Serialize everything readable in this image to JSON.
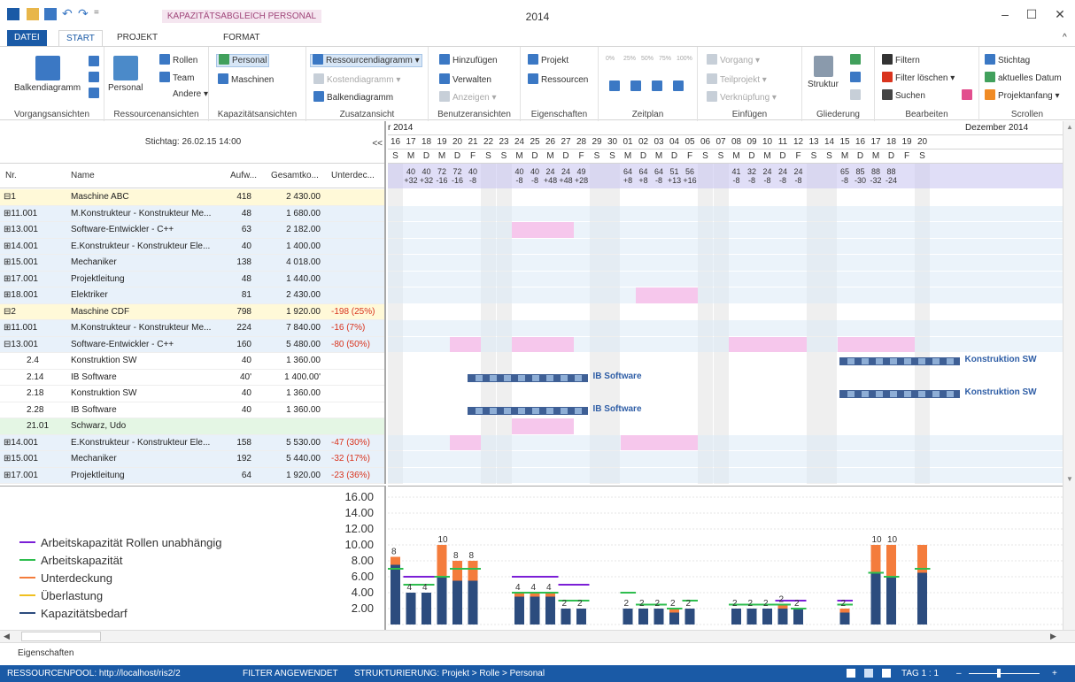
{
  "window": {
    "title": "2014",
    "context_tab_title": "KAPAZITÄTSABGLEICH PERSONAL",
    "min_label": "–",
    "max_label": "☐",
    "close_label": "✕",
    "collapse_label": "^"
  },
  "tabs": [
    {
      "label": "DATEI"
    },
    {
      "label": "START"
    },
    {
      "label": "PROJEKT"
    },
    {
      "label": "FORMAT"
    }
  ],
  "ribbon": {
    "vorgangsansichten": {
      "label": "Vorgangsansichten",
      "balkendiagramm": "Balkendiagramm"
    },
    "ressourcenansichten": {
      "label": "Ressourcenansichten",
      "personal": "Personal",
      "rollen": "Rollen",
      "team": "Team",
      "andere": "Andere ▾"
    },
    "kapazitaetsansichten": {
      "label": "Kapazitätsansichten",
      "personal": "Personal",
      "maschinen": "Maschinen"
    },
    "zusatzansicht": {
      "label": "Zusatzansicht",
      "ressourcendiagramm": "Ressourcendiagramm",
      "kostendiagramm": "Kostendiagramm ▾",
      "balkendiagramm": "Balkendiagramm"
    },
    "benutzeransichten": {
      "label": "Benutzeransichten",
      "hinzufuegen": "Hinzufügen",
      "verwalten": "Verwalten",
      "anzeigen": "Anzeigen ▾"
    },
    "eigenschaften": {
      "label": "Eigenschaften",
      "projekt": "Projekt",
      "ressourcen": "Ressourcen"
    },
    "zeitplan": {
      "label": "Zeitplan",
      "p0": "0%",
      "p25": "25%",
      "p50": "50%",
      "p75": "75%",
      "p100": "100%"
    },
    "einfuegen": {
      "label": "Einfügen",
      "vorgang": "Vorgang ▾",
      "teilprojekt": "Teilprojekt ▾",
      "verknuepfung": "Verknüpfung ▾"
    },
    "gliederung": {
      "label": "Gliederung",
      "struktur": "Struktur"
    },
    "bearbeiten": {
      "label": "Bearbeiten",
      "filtern": "Filtern",
      "filter_loeschen": "Filter löschen ▾",
      "suchen": "Suchen"
    },
    "scrollen": {
      "label": "Scrollen",
      "stichtag": "Stichtag",
      "aktuelles_datum": "aktuelles Datum",
      "projektanfang": "Projektanfang ▾"
    }
  },
  "left": {
    "stichtag": "Stichtag: 26.02.15 14:00",
    "collapse": "<<",
    "columns": [
      "Nr.",
      "Name",
      "Aufw...",
      "Gesamtko...",
      "Unterdec..."
    ],
    "rows": [
      {
        "nr": "⊟1",
        "name": "Maschine ABC",
        "aufw": "418",
        "kosten": "2 430.00",
        "unter": ""
      },
      {
        "nr": "⊞11.001",
        "name": "M.Konstrukteur - Konstrukteur Me...",
        "aufw": "48",
        "kosten": "1 680.00",
        "unter": ""
      },
      {
        "nr": "⊞13.001",
        "name": "Software-Entwickler - C++",
        "aufw": "63",
        "kosten": "2 182.00",
        "unter": ""
      },
      {
        "nr": "⊞14.001",
        "name": "E.Konstrukteur - Konstrukteur Ele...",
        "aufw": "40",
        "kosten": "1 400.00",
        "unter": ""
      },
      {
        "nr": "⊞15.001",
        "name": "Mechaniker",
        "aufw": "138",
        "kosten": "4 018.00",
        "unter": ""
      },
      {
        "nr": "⊞17.001",
        "name": "Projektleitung",
        "aufw": "48",
        "kosten": "1 440.00",
        "unter": ""
      },
      {
        "nr": "⊞18.001",
        "name": "Elektriker",
        "aufw": "81",
        "kosten": "2 430.00",
        "unter": ""
      },
      {
        "nr": "⊟2",
        "name": "Maschine CDF",
        "aufw": "798",
        "kosten": "1 920.00",
        "unter": "-198 (25%)"
      },
      {
        "nr": "⊞11.001",
        "name": "M.Konstrukteur - Konstrukteur Me...",
        "aufw": "224",
        "kosten": "7 840.00",
        "unter": "-16 (7%)"
      },
      {
        "nr": "⊟13.001",
        "name": "Software-Entwickler - C++",
        "aufw": "160",
        "kosten": "5 480.00",
        "unter": "-80 (50%)"
      },
      {
        "nr": "2.4",
        "name": "Konstruktion SW",
        "aufw": "40",
        "kosten": "1 360.00",
        "unter": ""
      },
      {
        "nr": "2.14",
        "name": "IB Software",
        "aufw": "40'",
        "kosten": "1 400.00'",
        "unter": ""
      },
      {
        "nr": "2.18",
        "name": "Konstruktion SW",
        "aufw": "40",
        "kosten": "1 360.00",
        "unter": ""
      },
      {
        "nr": "2.28",
        "name": "IB Software",
        "aufw": "40",
        "kosten": "1 360.00",
        "unter": ""
      },
      {
        "nr": "21.01",
        "name": "Schwarz, Udo",
        "aufw": "",
        "kosten": "",
        "unter": ""
      },
      {
        "nr": "⊞14.001",
        "name": "E.Konstrukteur - Konstrukteur Ele...",
        "aufw": "158",
        "kosten": "5 530.00",
        "unter": "-47 (30%)"
      },
      {
        "nr": "⊞15.001",
        "name": "Mechaniker",
        "aufw": "192",
        "kosten": "5 440.00",
        "unter": "-32 (17%)"
      },
      {
        "nr": "⊞17.001",
        "name": "Projektleitung",
        "aufw": "64",
        "kosten": "1 920.00",
        "unter": "-23 (36%)"
      }
    ]
  },
  "timeline": {
    "month_left": "r 2014",
    "month_right": "Dezember 2014",
    "days": [
      "16",
      "17",
      "18",
      "19",
      "20",
      "21",
      "22",
      "23",
      "24",
      "25",
      "26",
      "27",
      "28",
      "29",
      "30",
      "01",
      "02",
      "03",
      "04",
      "05",
      "06",
      "07",
      "08",
      "09",
      "10",
      "11",
      "12",
      "13",
      "14",
      "15",
      "16",
      "17",
      "18",
      "19",
      "20"
    ],
    "weekdays": [
      "S",
      "M",
      "D",
      "M",
      "D",
      "F",
      "S",
      "S",
      "M",
      "D",
      "M",
      "D",
      "F",
      "S",
      "S",
      "M",
      "D",
      "M",
      "D",
      "F",
      "S",
      "S",
      "M",
      "D",
      "M",
      "D",
      "F",
      "S",
      "S",
      "M",
      "D",
      "M",
      "D",
      "F",
      "S"
    ],
    "gantt_labels": [
      "IB Software",
      "Konstruktion SW",
      "IB Software",
      "Konstruktion SW"
    ],
    "row1_top": [
      "40",
      "40",
      "72",
      "72",
      "40",
      "40",
      "40",
      "24",
      "24",
      "49",
      "64",
      "64",
      "64",
      "51",
      "56",
      "41",
      "32",
      "24",
      "24",
      "24",
      "65",
      "85",
      "88",
      "88"
    ],
    "row1_bot": [
      "+32",
      "+32",
      "-16",
      "-16",
      "-8",
      "-8",
      "-8",
      "+48",
      "+48",
      "+28",
      "+8",
      "+8",
      "-8",
      "+13",
      "+16",
      "-8",
      "-8",
      "-8",
      "-8",
      "-8",
      "-8",
      "-30",
      "-32",
      "-24"
    ]
  },
  "chart": {
    "yticks": [
      "16.00",
      "14.00",
      "12.00",
      "10.00",
      "8.00",
      "6.00",
      "4.00",
      "2.00"
    ],
    "legend": [
      {
        "label": "Arbeitskapazität Rollen unabhängig",
        "color": "#7b1fd6"
      },
      {
        "label": "Arbeitskapazität",
        "color": "#2ebd4e"
      },
      {
        "label": "Unterdeckung",
        "color": "#f47c3c"
      },
      {
        "label": "Überlastung",
        "color": "#f0c020"
      },
      {
        "label": "Kapazitätsbedarf",
        "color": "#2c4c7e"
      }
    ]
  },
  "chart_data": {
    "type": "bar",
    "ylim": [
      0,
      16
    ],
    "categories": [
      "17",
      "18",
      "20",
      "21",
      "24",
      "25",
      "26",
      "27",
      "28",
      "01",
      "02",
      "03",
      "04",
      "05",
      "08",
      "09",
      "10",
      "11",
      "12",
      "15",
      "16",
      "17",
      "18",
      "19",
      "20"
    ],
    "series": [
      {
        "name": "Kapazitätsbedarf",
        "values": [
          4,
          4,
          5.5,
          5.5,
          3.5,
          3.5,
          3.5,
          2,
          2,
          2,
          2,
          2,
          1.5,
          2,
          2,
          2,
          2,
          2,
          2,
          1.5,
          7.5,
          6.5,
          6,
          6,
          6.5
        ]
      },
      {
        "name": "Unterdeckung",
        "values": [
          0,
          0,
          2.5,
          2.5,
          0.5,
          0.5,
          0.5,
          0,
          0,
          0,
          0,
          0,
          0.5,
          0,
          0,
          0,
          0,
          0.5,
          0,
          0.5,
          1,
          3.5,
          4,
          4,
          3.5
        ]
      },
      {
        "name": "Arbeitskapazität",
        "values": [
          5,
          5,
          7,
          7,
          4,
          4,
          4,
          3,
          3,
          4,
          2.5,
          2.5,
          2,
          3,
          2.5,
          2.5,
          2.5,
          2.5,
          2,
          2.5,
          7,
          6.5,
          6,
          6,
          7
        ]
      },
      {
        "name": "Arbeitskapazität Rollen unabhängig",
        "values": [
          6,
          6,
          0,
          0,
          6,
          6,
          6,
          5,
          5,
          0,
          0,
          0,
          0,
          0,
          0,
          0,
          0,
          3,
          3,
          3,
          0,
          0,
          0,
          0,
          0
        ]
      }
    ],
    "data_labels": [
      "4",
      "4",
      "8",
      "8",
      "4",
      "4",
      "4",
      "2",
      "2",
      "2",
      "2",
      "2",
      "2",
      "2",
      "2",
      "2",
      "2",
      "2",
      "2",
      "2",
      "8",
      "10",
      "10",
      "10"
    ]
  },
  "scroll": {
    "left_arrow": "◀",
    "right_arrow": "▶",
    "up_arrow": "▲",
    "down_arrow": "▼"
  },
  "props": {
    "label": "Eigenschaften"
  },
  "status": {
    "pool": "RESSOURCENPOOL: http://localhost/ris2/2",
    "filter": "FILTER ANGEWENDET",
    "strukt": "STRUKTURIERUNG: Projekt > Rolle > Personal",
    "tag": "TAG 1 : 1",
    "zoom_minus": "–",
    "zoom_plus": "+"
  },
  "colors": {
    "accent": "#1a5aa6",
    "yellow_row": "#fff9d8",
    "blue_row": "#e8f1fa",
    "green_row": "#e4f6e4",
    "pink_cell": "#f6c7ec",
    "negative": "#d9341e"
  }
}
